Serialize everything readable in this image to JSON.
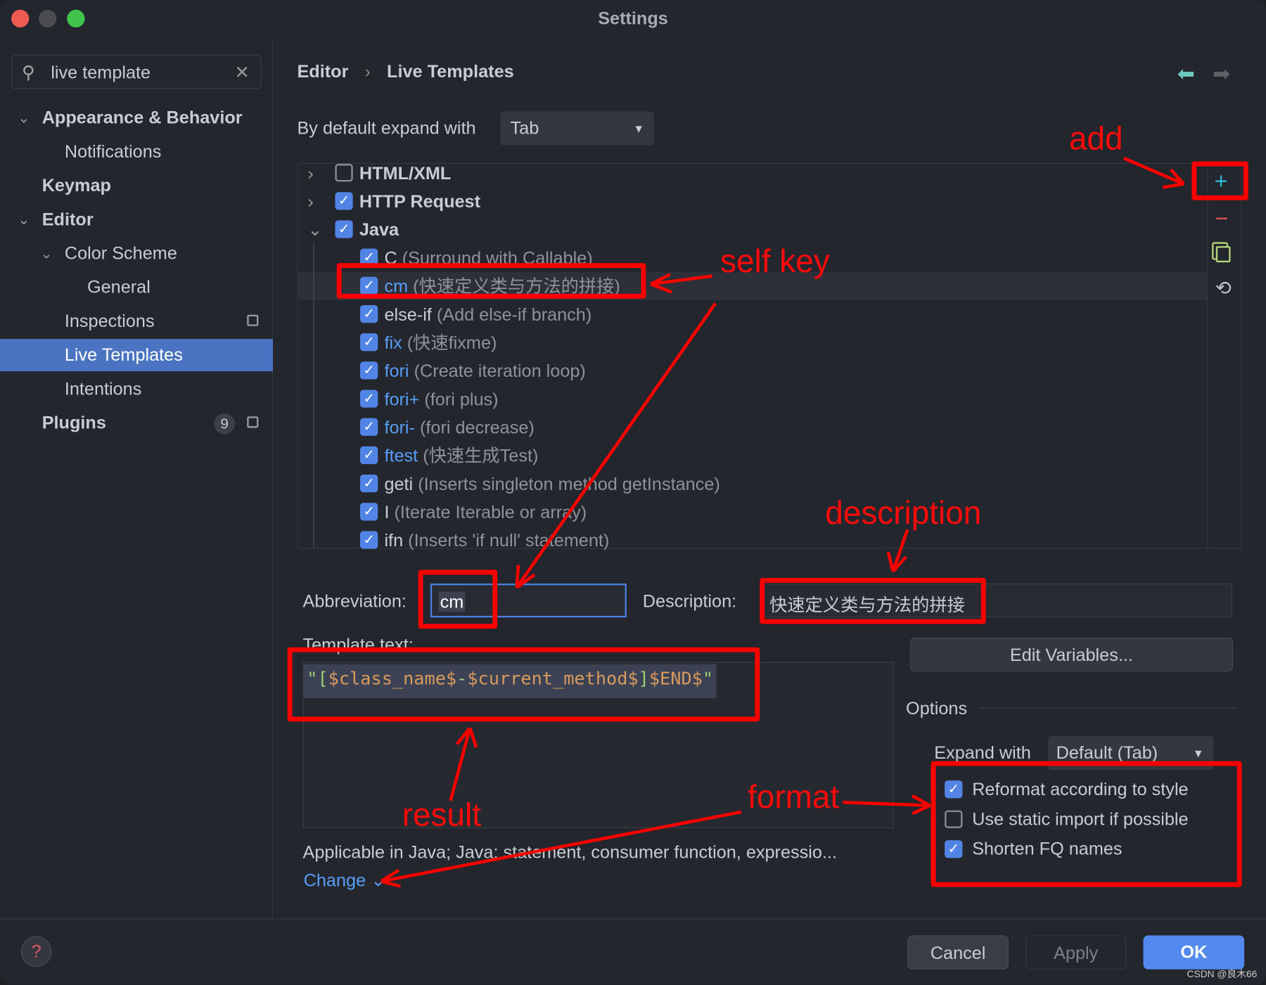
{
  "window": {
    "title": "Settings"
  },
  "sidebar": {
    "search_value": "live template",
    "items": [
      {
        "label": "Appearance & Behavior",
        "expanded": true
      },
      {
        "label": "Notifications"
      },
      {
        "label": "Keymap"
      },
      {
        "label": "Editor",
        "expanded": true
      },
      {
        "label": "Color Scheme",
        "expanded": true
      },
      {
        "label": "General"
      },
      {
        "label": "Inspections"
      },
      {
        "label": "Live Templates",
        "selected": true
      },
      {
        "label": "Intentions"
      },
      {
        "label": "Plugins",
        "badge": "9"
      }
    ]
  },
  "breadcrumb": {
    "parent": "Editor",
    "current": "Live Templates",
    "separator": "›"
  },
  "expand_default": {
    "label": "By default expand with",
    "value": "Tab"
  },
  "tree": {
    "groups": [
      {
        "label": "HTML/XML",
        "checked": false
      },
      {
        "label": "HTTP Request",
        "checked": true
      },
      {
        "label": "Java",
        "checked": true
      }
    ],
    "items": [
      {
        "key": "C",
        "desc": "(Surround with Callable)",
        "custom": false
      },
      {
        "key": "cm",
        "desc": "(快速定义类与方法的拼接)",
        "custom": true
      },
      {
        "key": "else-if",
        "desc": "(Add else-if branch)",
        "custom": false
      },
      {
        "key": "fix",
        "desc": "(快速fixme)",
        "custom": true
      },
      {
        "key": "fori",
        "desc": "(Create iteration loop)",
        "custom": true
      },
      {
        "key": "fori+",
        "desc": "(fori plus)",
        "custom": true
      },
      {
        "key": "fori-",
        "desc": "(fori decrease)",
        "custom": true
      },
      {
        "key": "ftest",
        "desc": "(快速生成Test)",
        "custom": true
      },
      {
        "key": "geti",
        "desc": "(Inserts singleton method getInstance)",
        "custom": false
      },
      {
        "key": "I",
        "desc": "(Iterate Iterable or array)",
        "custom": false
      },
      {
        "key": "ifn",
        "desc": "(Inserts 'if null' statement)",
        "custom": false
      }
    ]
  },
  "toolbar": {
    "add": "+",
    "remove": "−"
  },
  "editor": {
    "abbreviation_label": "Abbreviation:",
    "abbreviation_value": "cm",
    "description_label": "Description:",
    "description_value": "快速定义类与方法的拼接",
    "template_label": "Template text:",
    "template_parts": [
      "\"[",
      "$class_name$",
      "-",
      "$current_method$",
      "]",
      "$END$",
      "\""
    ],
    "edit_variables": "Edit Variables...",
    "applicable": "Applicable in Java; Java: statement, consumer function, expressio...",
    "change": "Change"
  },
  "options": {
    "title": "Options",
    "expand_label": "Expand with",
    "expand_value": "Default (Tab)",
    "checks": [
      {
        "label": "Reformat according to style",
        "checked": true
      },
      {
        "label": "Use static import if possible",
        "checked": false
      },
      {
        "label": "Shorten FQ names",
        "checked": true
      }
    ]
  },
  "footer": {
    "cancel": "Cancel",
    "apply": "Apply",
    "ok": "OK",
    "help": "?"
  },
  "annotations": {
    "add": "add",
    "self_key": "self key",
    "description": "description",
    "result": "result",
    "format": "format"
  },
  "watermark": "CSDN @良木66",
  "colors": {
    "accent": "#4a74c2",
    "annotation": "#ff0000",
    "ok": "#548af0"
  }
}
